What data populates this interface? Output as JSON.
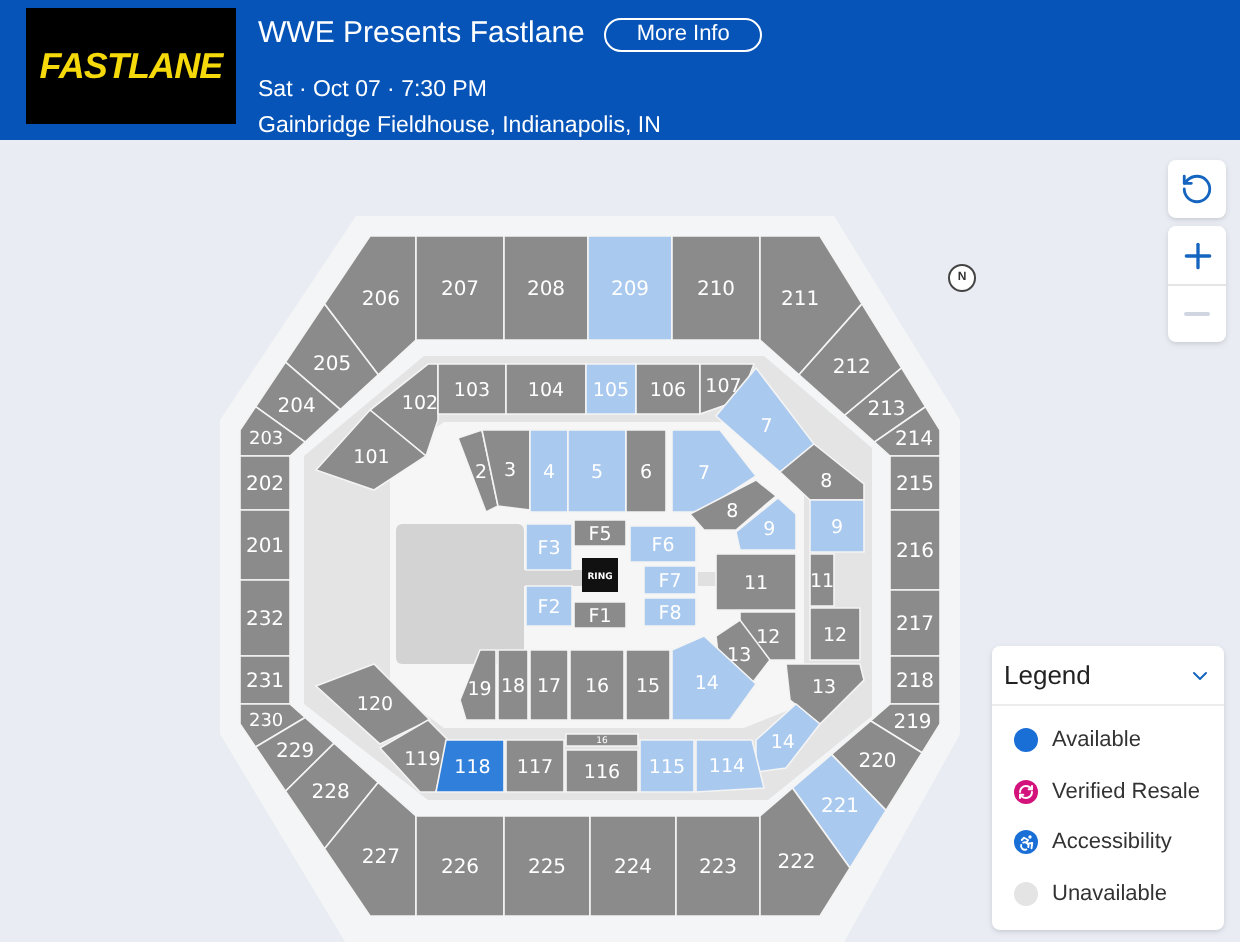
{
  "event": {
    "logo_text": "FASTLANE",
    "title": "WWE Presents Fastlane",
    "more_info": "More Info",
    "date": "Sat · Oct 07 · 7:30 PM",
    "venue": "Gainbridge Fieldhouse, Indianapolis, IN"
  },
  "map_controls": {
    "zoom_out_disabled": true
  },
  "compass_label": "N",
  "ring_label": "RING",
  "level_200": [
    {
      "label": "206",
      "available": false,
      "selected": false
    },
    {
      "label": "207",
      "available": false,
      "selected": false
    },
    {
      "label": "208",
      "available": false,
      "selected": false
    },
    {
      "label": "209",
      "available": true,
      "selected": false
    },
    {
      "label": "210",
      "available": false,
      "selected": false
    },
    {
      "label": "211",
      "available": false,
      "selected": false
    },
    {
      "label": "205",
      "available": false,
      "selected": false
    },
    {
      "label": "204",
      "available": false,
      "selected": false
    },
    {
      "label": "203",
      "available": false,
      "selected": false
    },
    {
      "label": "202",
      "available": false,
      "selected": false
    },
    {
      "label": "201",
      "available": false,
      "selected": false
    },
    {
      "label": "232",
      "available": false,
      "selected": false
    },
    {
      "label": "231",
      "available": false,
      "selected": false
    },
    {
      "label": "230",
      "available": false,
      "selected": false
    },
    {
      "label": "229",
      "available": false,
      "selected": false
    },
    {
      "label": "228",
      "available": false,
      "selected": false
    },
    {
      "label": "212",
      "available": false,
      "selected": false
    },
    {
      "label": "213",
      "available": false,
      "selected": false
    },
    {
      "label": "214",
      "available": false,
      "selected": false
    },
    {
      "label": "215",
      "available": false,
      "selected": false
    },
    {
      "label": "216",
      "available": false,
      "selected": false
    },
    {
      "label": "217",
      "available": false,
      "selected": false
    },
    {
      "label": "218",
      "available": false,
      "selected": false
    },
    {
      "label": "219",
      "available": false,
      "selected": false
    },
    {
      "label": "220",
      "available": false,
      "selected": false
    },
    {
      "label": "221",
      "available": true,
      "selected": false
    },
    {
      "label": "227",
      "available": false,
      "selected": false
    },
    {
      "label": "226",
      "available": false,
      "selected": false
    },
    {
      "label": "225",
      "available": false,
      "selected": false
    },
    {
      "label": "224",
      "available": false,
      "selected": false
    },
    {
      "label": "223",
      "available": false,
      "selected": false
    },
    {
      "label": "222",
      "available": false,
      "selected": false
    }
  ],
  "level_100": [
    {
      "label": "102",
      "available": false,
      "selected": false
    },
    {
      "label": "103",
      "available": false,
      "selected": false
    },
    {
      "label": "104",
      "available": false,
      "selected": false
    },
    {
      "label": "105",
      "available": true,
      "selected": false
    },
    {
      "label": "106",
      "available": false,
      "selected": false
    },
    {
      "label": "107",
      "available": false,
      "selected": false
    },
    {
      "label": "101",
      "available": false,
      "selected": false
    },
    {
      "label": "120",
      "available": false,
      "selected": false
    },
    {
      "label": "119",
      "available": false,
      "selected": false
    },
    {
      "label": "7",
      "available": true,
      "selected": false
    },
    {
      "label": "8",
      "available": false,
      "selected": false
    },
    {
      "label": "9",
      "available": true,
      "selected": false
    },
    {
      "label": "11",
      "available": false,
      "selected": false
    },
    {
      "label": "12",
      "available": false,
      "selected": false
    },
    {
      "label": "13",
      "available": false,
      "selected": false
    },
    {
      "label": "14",
      "available": true,
      "selected": false
    },
    {
      "label": "118",
      "available": true,
      "selected": true
    },
    {
      "label": "117",
      "available": false,
      "selected": false
    },
    {
      "label": "16",
      "available": false,
      "selected": false
    },
    {
      "label": "116",
      "available": false,
      "selected": false
    },
    {
      "label": "115",
      "available": true,
      "selected": false
    },
    {
      "label": "114",
      "available": true,
      "selected": false
    }
  ],
  "floor_ring": [
    {
      "label": "2",
      "available": false,
      "selected": false
    },
    {
      "label": "3",
      "available": false,
      "selected": false
    },
    {
      "label": "4",
      "available": true,
      "selected": false
    },
    {
      "label": "5",
      "available": true,
      "selected": false
    },
    {
      "label": "6",
      "available": false,
      "selected": false
    },
    {
      "label": "7",
      "available": true,
      "selected": false
    },
    {
      "label": "8",
      "available": false,
      "selected": false
    },
    {
      "label": "9",
      "available": true,
      "selected": false
    },
    {
      "label": "11",
      "available": false,
      "selected": false
    },
    {
      "label": "12",
      "available": false,
      "selected": false
    },
    {
      "label": "13",
      "available": false,
      "selected": false
    },
    {
      "label": "14",
      "available": true,
      "selected": false
    },
    {
      "label": "19",
      "available": false,
      "selected": false
    },
    {
      "label": "18",
      "available": false,
      "selected": false
    },
    {
      "label": "17",
      "available": false,
      "selected": false
    },
    {
      "label": "16",
      "available": false,
      "selected": false
    },
    {
      "label": "15",
      "available": false,
      "selected": false
    }
  ],
  "floor_seats": [
    {
      "label": "F3",
      "available": true,
      "selected": false
    },
    {
      "label": "F5",
      "available": false,
      "selected": false
    },
    {
      "label": "F6",
      "available": true,
      "selected": false
    },
    {
      "label": "F7",
      "available": true,
      "selected": false
    },
    {
      "label": "F2",
      "available": true,
      "selected": false
    },
    {
      "label": "F1",
      "available": false,
      "selected": false
    },
    {
      "label": "F8",
      "available": true,
      "selected": false
    }
  ],
  "legend": {
    "title": "Legend",
    "expanded": true,
    "items": [
      {
        "kind": "dot",
        "label": "Available",
        "color": "#1a6fd6"
      },
      {
        "kind": "resale",
        "label": "Verified Resale",
        "color": "#d4127c"
      },
      {
        "kind": "accessibility",
        "label": "Accessibility",
        "color": "#1a6fd6"
      },
      {
        "kind": "dot",
        "label": "Unavailable",
        "color": "#e4e4e4"
      }
    ]
  }
}
